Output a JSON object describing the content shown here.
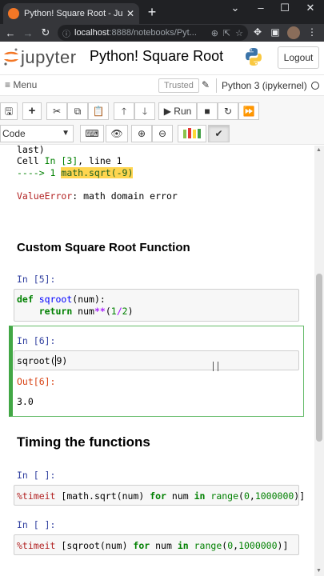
{
  "browser": {
    "tab_title": "Python! Square Root - Jupyter No",
    "tab_close": "✕",
    "new_tab": "+",
    "url_host": "localhost",
    "url_rest": ":8888/notebooks/Pyt...",
    "win_minimize": "–",
    "win_maximize": "☐",
    "win_close": "✕"
  },
  "jupyter": {
    "logo_text": "jupyter",
    "notebook_title": "Python! Square Root",
    "logout_label": "Logout",
    "menu_label": "≡ Menu",
    "trusted_label": "Trusted",
    "kernel_label": "Python 3 (ipykernel)",
    "run_label": "Run",
    "cell_type": "Code"
  },
  "traceback": {
    "line1": "last)",
    "line2_pre": "Cell ",
    "line2_in": "In [3]",
    "line2_post": ", line 1",
    "line3_arrow": "----> 1 ",
    "line3_code": "math.sqrt(-9)",
    "error_name": "ValueError",
    "error_msg": ": math domain error"
  },
  "sections": {
    "custom_heading": "Custom Square Root Function",
    "timing_heading": "Timing the functions"
  },
  "cells": [
    {
      "prompt": "In [5]:",
      "def_kw": "def",
      "fn_name": "sqroot",
      "params": "(num):",
      "return_kw": "return",
      "ret_var": " num",
      "ret_op": "**",
      "ret_open": "(",
      "ret_n1": "1",
      "ret_slash": "/",
      "ret_n2": "2",
      "ret_close": ")"
    },
    {
      "prompt": "In [6]:",
      "code_pre": "sqroot(",
      "code_arg": "9",
      "code_post": ")",
      "out_prompt": "Out[6]:",
      "output": "3.0"
    },
    {
      "prompt": "In [ ]:",
      "magic": "%timeit",
      "open": " [",
      "call": "math.sqrt(num) ",
      "for_kw": "for",
      "var": " num ",
      "in_kw": "in",
      "sp": " ",
      "range_fn": "range",
      "range_open": "(",
      "range_a": "0",
      "comma": ",",
      "range_b": "1000000",
      "close": ")]"
    },
    {
      "prompt": "In [ ]:",
      "magic": "%timeit",
      "open": " [",
      "call": "sqroot(num) ",
      "for_kw": "for",
      "var": " num ",
      "in_kw": "in",
      "sp": " ",
      "range_fn": "range",
      "range_open": "(",
      "range_a": "0",
      "comma": ",",
      "range_b": "1000000",
      "close": ")]"
    }
  ],
  "colors": {
    "accent_orange": "#f37726",
    "selected_cell_border": "#42a745",
    "prompt_in": "#303f9f",
    "prompt_out": "#d84315",
    "highlight": "#ffd54f"
  }
}
